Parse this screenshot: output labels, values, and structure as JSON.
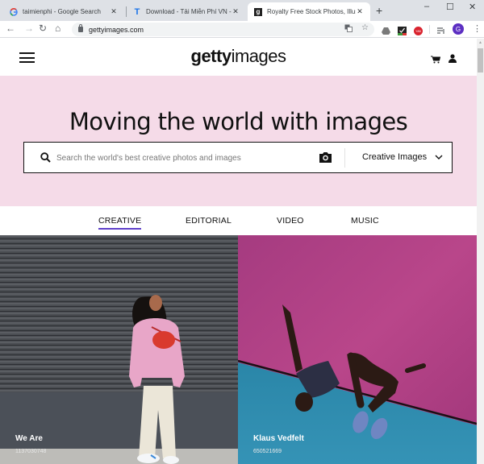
{
  "browser": {
    "tabs": [
      {
        "title": "taimienphi - Google Search",
        "favicon": "google-g-icon",
        "active": false
      },
      {
        "title": "Download - Tải Miễn Phí VN - Ph",
        "favicon": "taimienphi-t-icon",
        "active": false
      },
      {
        "title": "Royalty Free Stock Photos, Illustra",
        "favicon": "getty-g-icon",
        "active": true
      }
    ],
    "new_tab_label": "+",
    "window_controls": {
      "minimize": "–",
      "maximize": "☐",
      "close": "✕"
    },
    "close_tab_glyph": "✕",
    "nav": {
      "back": "←",
      "forward": "→",
      "reload": "↻",
      "home": "⌂"
    },
    "url": "gettyimages.com",
    "profile_initial": "G",
    "menu_glyph": "⋮",
    "omnibox_icons": [
      "translate-icon",
      "star-icon"
    ],
    "extensions": [
      "drive-icon",
      "checkmark-extension-icon",
      "yab-extension-icon",
      "media-queue-icon"
    ]
  },
  "site": {
    "logo": {
      "bold": "getty",
      "light": "images"
    },
    "header_icons": [
      "menu-icon",
      "cart-icon",
      "account-icon"
    ],
    "hero": {
      "title": "Moving the world with images",
      "search_placeholder": "Search the world's best creative photos and images",
      "search_value": "",
      "search_type": "Creative Images"
    },
    "content_tabs": [
      {
        "label": "CREATIVE",
        "active": true
      },
      {
        "label": "EDITORIAL",
        "active": false
      },
      {
        "label": "VIDEO",
        "active": false
      },
      {
        "label": "MUSIC",
        "active": false
      }
    ],
    "tiles": [
      {
        "credit": "We Are",
        "image_id": "1137030748",
        "subject": "woman in pink hoodie with red bag against grey shutter"
      },
      {
        "credit": "Klaus Vedfelt",
        "image_id": "650521669",
        "subject": "high jumper clearing bar against pink and blue sky"
      }
    ]
  },
  "colors": {
    "hero_bg": "#f5dbe8",
    "active_tab_underline": "#5d3ec9",
    "profile_avatar": "#5c2fc2"
  }
}
